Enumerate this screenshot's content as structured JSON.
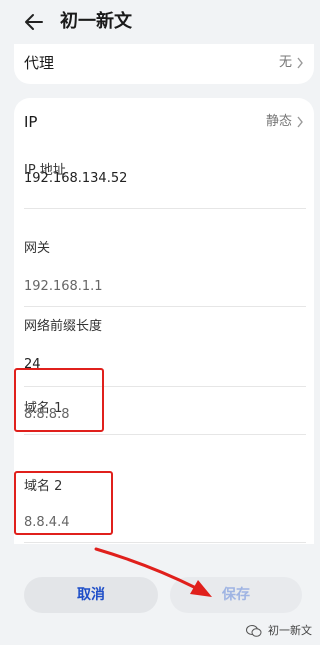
{
  "header": {
    "title": "初一新文",
    "back_icon": "back-arrow-icon"
  },
  "proxy": {
    "label": "代理",
    "value": "无"
  },
  "ip_mode": {
    "label": "IP",
    "value": "静态"
  },
  "fields": {
    "ip_address": {
      "label": "IP 地址",
      "value": "192.168.134.52"
    },
    "gateway": {
      "label": "网关",
      "value": "192.168.1.1"
    },
    "prefix": {
      "label": "网络前缀长度",
      "value": "24"
    },
    "dns1": {
      "label": "域名 1",
      "value": "8.8.8.8"
    },
    "dns2": {
      "label": "域名 2",
      "value": "8.8.4.4"
    }
  },
  "buttons": {
    "cancel": "取消",
    "save": "保存"
  },
  "watermark": {
    "text": "初一新文",
    "icon": "wechat-icon"
  },
  "colors": {
    "accent": "#1f4fc8",
    "highlight": "#e0201c",
    "background": "#f1f3f5"
  }
}
